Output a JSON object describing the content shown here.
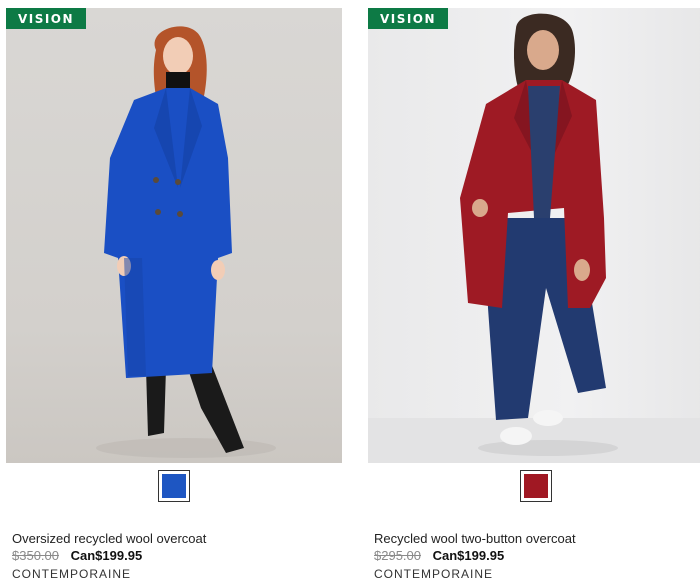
{
  "products": [
    {
      "badge": "VISION",
      "name": "Oversized recycled wool overcoat",
      "original_price": "$350.00",
      "sale_price": "Can$199.95",
      "brand": "CONTEMPORAINE",
      "swatch_color": "#1e56c2",
      "coat_color": "#1a4fc4"
    },
    {
      "badge": "VISION",
      "name": "Recycled wool two-button overcoat",
      "original_price": "$295.00",
      "sale_price": "Can$199.95",
      "brand": "CONTEMPORAINE",
      "swatch_color": "#a01823",
      "coat_color": "#9e1a24"
    }
  ],
  "colors": {
    "badge_bg": "#0d7a45",
    "old_price": "#8a8a8a"
  }
}
